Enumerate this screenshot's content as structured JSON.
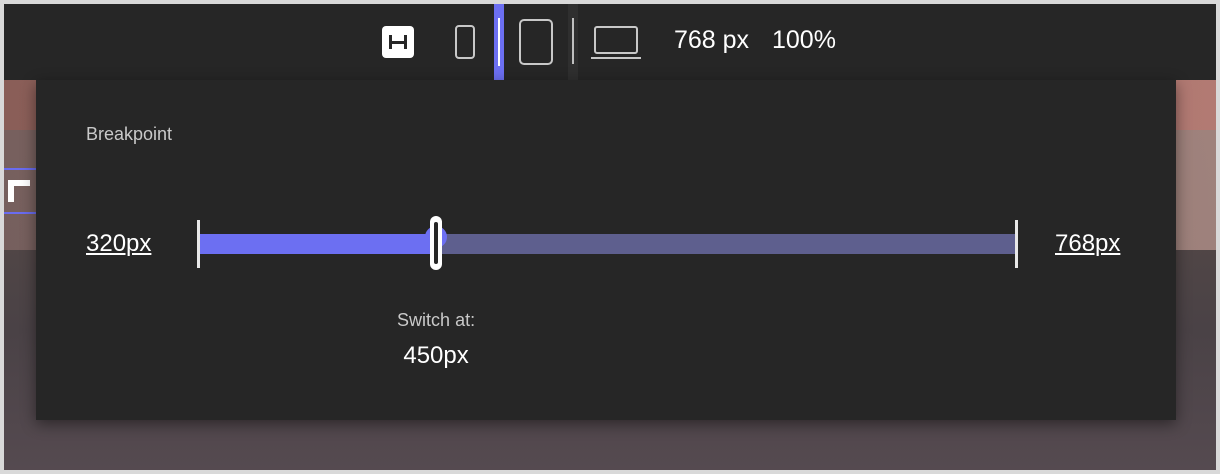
{
  "toolbar": {
    "tools": [
      {
        "name": "fit-to-width",
        "icon": "fit-width-icon"
      },
      {
        "name": "mobile",
        "icon": "phone-icon"
      },
      {
        "name": "tablet",
        "icon": "tablet-icon"
      },
      {
        "name": "desktop",
        "icon": "laptop-icon"
      }
    ],
    "width_label": "768 px",
    "zoom_label": "100%"
  },
  "breakpoint_panel": {
    "title": "Breakpoint",
    "min_label": "320px",
    "max_label": "768px",
    "min_value": 320,
    "max_value": 768,
    "switch_value": 450,
    "switch_label": "Switch at:",
    "switch_value_label": "450px"
  },
  "colors": {
    "accent": "#6c6ff2",
    "track": "#5e5f8e",
    "panel_bg": "#262626"
  }
}
